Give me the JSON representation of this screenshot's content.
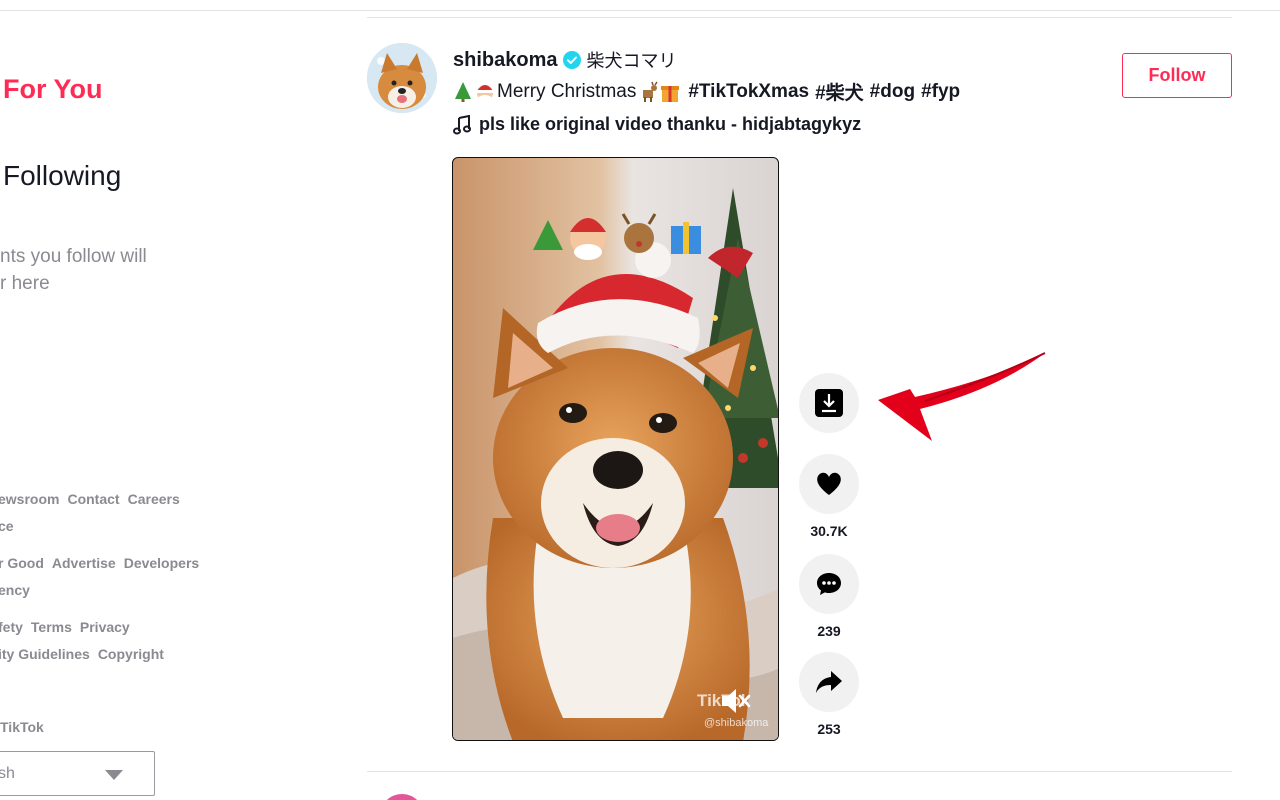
{
  "sidebar": {
    "nav_for_you": "For You",
    "nav_following": "Following",
    "following_hint_line1": "nts you follow will",
    "following_hint_line2": "r here",
    "footer_rows": [
      [
        "ewsroom",
        "Contact",
        "Careers"
      ],
      [
        "ce"
      ],
      [
        "r Good",
        "Advertise",
        "Developers"
      ],
      [
        "ency"
      ],
      [
        "fety",
        "Terms",
        "Privacy"
      ],
      [
        "ity Guidelines",
        "Copyright"
      ]
    ],
    "copyright": "TikTok",
    "language": "sh"
  },
  "post": {
    "author": "shibakoma",
    "nickname": "柴犬コマリ",
    "caption_text": "Merry Christmas",
    "hashtags": [
      "#TikTokXmas",
      "#柴犬",
      "#dog",
      "#fyp"
    ],
    "music": "pls like original video thanku - hidjabtagykyz",
    "follow_label": "Follow",
    "watermark_brand": "TikTok",
    "watermark_user": "@shibakoma",
    "actions": {
      "download_icon": "download-icon",
      "likes": "30.7K",
      "comments": "239",
      "shares": "253"
    }
  },
  "colors": {
    "accent": "#fe2c55",
    "text": "#161823",
    "muted": "#8a8b91",
    "action_bg": "#f1f1f2",
    "annotation_arrow": "#e3001b"
  }
}
